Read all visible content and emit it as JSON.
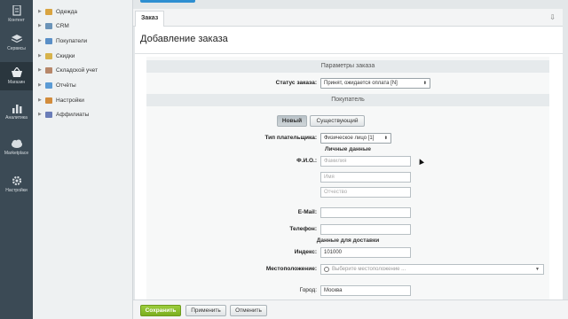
{
  "rail": {
    "items": [
      {
        "label": "Контент",
        "icon": "document-icon"
      },
      {
        "label": "Сервисы",
        "icon": "layers-icon"
      },
      {
        "label": "Магазин",
        "icon": "basket-icon",
        "active": true
      },
      {
        "label": "Аналитика",
        "icon": "bar-chart-icon"
      },
      {
        "label": "Marketplace",
        "icon": "cloud-icon"
      },
      {
        "label": "Настройки",
        "icon": "gear-icon"
      }
    ]
  },
  "tree": {
    "items": [
      {
        "label": "Одежда",
        "color": "#d9a441"
      },
      {
        "label": "CRM",
        "color": "#6a93b8"
      },
      {
        "label": "Покупатели",
        "color": "#5a8fc7"
      },
      {
        "label": "Скидки",
        "color": "#d7b34c"
      },
      {
        "label": "Складской учет",
        "color": "#b7876a"
      },
      {
        "label": "Отчёты",
        "color": "#5b9bd5"
      },
      {
        "label": "Настройки",
        "color": "#d28c3c"
      },
      {
        "label": "Аффилиаты",
        "color": "#6a7db8"
      }
    ]
  },
  "tabs": {
    "active": "Заказ",
    "pin": "⇩"
  },
  "form": {
    "title": "Добавление заказа",
    "section_params": "Параметры заказа",
    "status_label": "Статус заказа:",
    "status_value": "Принят, ожидается оплата [N]",
    "section_buyer": "Покупатель",
    "buyer_new": "Новый",
    "buyer_existing": "Существующий",
    "payer_type_label": "Тип плательщика:",
    "payer_type_value": "Физическое лицо [1]",
    "personal_data": "Личные данные",
    "fio_label": "Ф.И.О.:",
    "lastname_placeholder": "Фамилия",
    "firstname_placeholder": "Имя",
    "middlename_placeholder": "Отчество",
    "email_label": "E-Mail:",
    "email_value": "",
    "phone_label": "Телефон:",
    "phone_value": "",
    "delivery_data": "Данные для доставки",
    "index_label": "Индекс:",
    "index_value": "101000",
    "location_label": "Местоположение:",
    "location_placeholder": "Выберите местоположение ...",
    "city_label": "Город:",
    "city_value": "Москва"
  },
  "footer": {
    "save": "Сохранить",
    "apply": "Применить",
    "cancel": "Отменить"
  },
  "colors": {
    "accent_blue": "#2f8fd1",
    "save_green": "#8bbe2c",
    "rail": "#3b4a55"
  }
}
